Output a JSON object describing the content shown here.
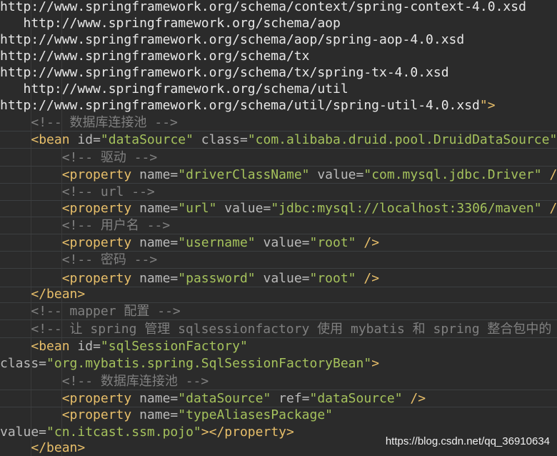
{
  "colors": {
    "background": "#2b2b2b",
    "plain_text": "#e8e8e8",
    "tag": "#e8bf6a",
    "attribute": "#bababa",
    "string": "#a5c25c",
    "comment": "#808080"
  },
  "editor": {
    "lines": [
      {
        "tokens": [
          {
            "t": "http://www.springframework.org/schema/context/spring-context-4.0.xsd",
            "k": "url"
          }
        ]
      },
      {
        "tokens": [
          {
            "t": "   http://www.springframework.org/schema/aop",
            "k": "url"
          }
        ]
      },
      {
        "tokens": [
          {
            "t": "http://www.springframework.org/schema/aop/spring-aop-4.0.xsd",
            "k": "url"
          }
        ]
      },
      {
        "tokens": [
          {
            "t": "http://www.springframework.org/schema/tx",
            "k": "url"
          }
        ]
      },
      {
        "tokens": [
          {
            "t": "http://www.springframework.org/schema/tx/spring-tx-4.0.xsd",
            "k": "url"
          }
        ]
      },
      {
        "tokens": [
          {
            "t": "   http://www.springframework.org/schema/util",
            "k": "url"
          }
        ]
      },
      {
        "tokens": [
          {
            "t": "http://www.springframework.org/schema/util/spring-util-4.0.xsd",
            "k": "url"
          },
          {
            "t": "\">",
            "k": "tag"
          }
        ]
      },
      {
        "tokens": [
          {
            "t": "    ",
            "k": "plain"
          },
          {
            "t": "<!-- 数据库连接池 -->",
            "k": "comment"
          }
        ]
      },
      {
        "tokens": [
          {
            "t": "    ",
            "k": "plain"
          },
          {
            "t": "<bean ",
            "k": "tag"
          },
          {
            "t": "id=",
            "k": "attr"
          },
          {
            "t": "\"dataSource\"",
            "k": "str"
          },
          {
            "t": " class=",
            "k": "attr"
          },
          {
            "t": "\"com.alibaba.druid.pool.DruidDataSource\"",
            "k": "str"
          },
          {
            "t": ">",
            "k": "tag"
          }
        ]
      },
      {
        "tokens": [
          {
            "t": "        ",
            "k": "plain"
          },
          {
            "t": "<!-- 驱动 -->",
            "k": "comment"
          }
        ]
      },
      {
        "tokens": [
          {
            "t": "        ",
            "k": "plain"
          },
          {
            "t": "<property ",
            "k": "tag"
          },
          {
            "t": "name=",
            "k": "attr"
          },
          {
            "t": "\"driverClassName\"",
            "k": "str"
          },
          {
            "t": " value=",
            "k": "attr"
          },
          {
            "t": "\"com.mysql.jdbc.Driver\"",
            "k": "str"
          },
          {
            "t": " />",
            "k": "tag"
          }
        ]
      },
      {
        "tokens": [
          {
            "t": "        ",
            "k": "plain"
          },
          {
            "t": "<!-- url -->",
            "k": "comment"
          }
        ]
      },
      {
        "tokens": [
          {
            "t": "        ",
            "k": "plain"
          },
          {
            "t": "<property ",
            "k": "tag"
          },
          {
            "t": "name=",
            "k": "attr"
          },
          {
            "t": "\"url\"",
            "k": "str"
          },
          {
            "t": " value=",
            "k": "attr"
          },
          {
            "t": "\"jdbc:mysql://localhost:3306/maven\"",
            "k": "str"
          },
          {
            "t": " />",
            "k": "tag"
          }
        ]
      },
      {
        "tokens": [
          {
            "t": "        ",
            "k": "plain"
          },
          {
            "t": "<!-- 用户名 -->",
            "k": "comment"
          }
        ]
      },
      {
        "tokens": [
          {
            "t": "        ",
            "k": "plain"
          },
          {
            "t": "<property ",
            "k": "tag"
          },
          {
            "t": "name=",
            "k": "attr"
          },
          {
            "t": "\"username\"",
            "k": "str"
          },
          {
            "t": " value=",
            "k": "attr"
          },
          {
            "t": "\"root\"",
            "k": "str"
          },
          {
            "t": " />",
            "k": "tag"
          }
        ]
      },
      {
        "tokens": [
          {
            "t": "        ",
            "k": "plain"
          },
          {
            "t": "<!-- 密码 -->",
            "k": "comment"
          }
        ]
      },
      {
        "tokens": [
          {
            "t": "        ",
            "k": "plain"
          },
          {
            "t": "<property ",
            "k": "tag"
          },
          {
            "t": "name=",
            "k": "attr"
          },
          {
            "t": "\"password\"",
            "k": "str"
          },
          {
            "t": " value=",
            "k": "attr"
          },
          {
            "t": "\"root\"",
            "k": "str"
          },
          {
            "t": " />",
            "k": "tag"
          }
        ]
      },
      {
        "tokens": [
          {
            "t": "    ",
            "k": "plain"
          },
          {
            "t": "</bean>",
            "k": "tag"
          }
        ]
      },
      {
        "tokens": [
          {
            "t": "    ",
            "k": "plain"
          },
          {
            "t": "<!-- mapper 配置 -->",
            "k": "comment"
          }
        ]
      },
      {
        "tokens": [
          {
            "t": "    ",
            "k": "plain"
          },
          {
            "t": "<!-- 让 spring 管理 sqlsessionfactory 使用 mybatis 和 spring 整合包中的 -->",
            "k": "comment"
          }
        ]
      },
      {
        "tokens": [
          {
            "t": "    ",
            "k": "plain"
          },
          {
            "t": "<bean ",
            "k": "tag"
          },
          {
            "t": "id=",
            "k": "attr"
          },
          {
            "t": "\"sqlSessionFactory\"",
            "k": "str"
          }
        ]
      },
      {
        "tokens": [
          {
            "t": "class=",
            "k": "attr"
          },
          {
            "t": "\"org.mybatis.spring.SqlSessionFactoryBean\"",
            "k": "str"
          },
          {
            "t": ">",
            "k": "tag"
          }
        ]
      },
      {
        "tokens": [
          {
            "t": "        ",
            "k": "plain"
          },
          {
            "t": "<!-- 数据库连接池 -->",
            "k": "comment"
          }
        ]
      },
      {
        "tokens": [
          {
            "t": "        ",
            "k": "plain"
          },
          {
            "t": "<property ",
            "k": "tag"
          },
          {
            "t": "name=",
            "k": "attr"
          },
          {
            "t": "\"dataSource\"",
            "k": "str"
          },
          {
            "t": " ref=",
            "k": "attr"
          },
          {
            "t": "\"dataSource\"",
            "k": "str"
          },
          {
            "t": " />",
            "k": "tag"
          }
        ]
      },
      {
        "tokens": [
          {
            "t": "        ",
            "k": "plain"
          },
          {
            "t": "<property ",
            "k": "tag"
          },
          {
            "t": "name=",
            "k": "attr"
          },
          {
            "t": "\"typeAliasesPackage\"",
            "k": "str"
          }
        ]
      },
      {
        "tokens": [
          {
            "t": "value=",
            "k": "attr"
          },
          {
            "t": "\"cn.itcast.ssm.pojo\"",
            "k": "str"
          },
          {
            "t": "></property>",
            "k": "tag"
          }
        ]
      },
      {
        "tokens": [
          {
            "t": "    ",
            "k": "plain"
          },
          {
            "t": "</bean>",
            "k": "tag"
          }
        ]
      }
    ]
  },
  "watermark": {
    "text": "https://blog.csdn.net/qq_36910634"
  }
}
